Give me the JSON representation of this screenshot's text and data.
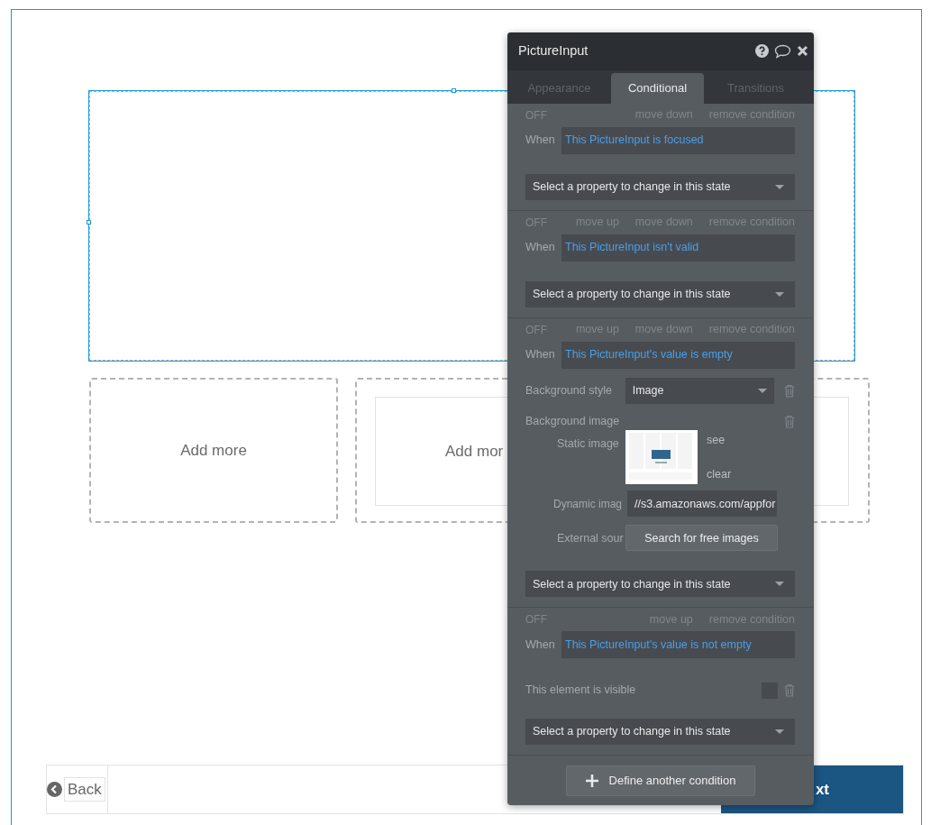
{
  "canvas": {
    "cards": [
      {
        "label": "Add more",
        "kind": "plain"
      },
      {
        "label": "Add mor",
        "kind": "framed"
      }
    ],
    "footer": {
      "back": "Back",
      "next": "xt"
    }
  },
  "panel": {
    "title": "PictureInput",
    "tabs": [
      {
        "label": "Appearance",
        "selected": false
      },
      {
        "label": "Conditional",
        "selected": true
      },
      {
        "label": "Transitions",
        "selected": false
      }
    ],
    "conditions": [
      {
        "status": "OFF",
        "actions": [
          "move down",
          "remove condition"
        ],
        "when_label": "When",
        "expression": "This PictureInput is focused",
        "property_select": "Select a property to change in this state"
      },
      {
        "status": "OFF",
        "actions": [
          "move up",
          "move down",
          "remove condition"
        ],
        "when_label": "When",
        "expression": "This PictureInput isn't valid",
        "property_select": "Select a property to change in this state"
      },
      {
        "status": "OFF",
        "actions": [
          "move up",
          "move down",
          "remove condition"
        ],
        "when_label": "When",
        "expression": "This PictureInput's value is empty",
        "properties": [
          {
            "kind": "dropdown",
            "label": "Background style",
            "value": "Image"
          },
          {
            "label": "Background image",
            "static_label": "Static image",
            "see": "see",
            "clear": "clear",
            "dynamic_label": "Dynamic imag",
            "dynamic_value": "//s3.amazonaws.com/appfor",
            "external_label": "External sour",
            "button": "Search for free images"
          }
        ],
        "property_select": "Select a property to change in this state"
      },
      {
        "status": "OFF",
        "actions": [
          "move up",
          "remove condition"
        ],
        "when_label": "When",
        "expression": "This PictureInput's value is not empty",
        "properties": [
          {
            "kind": "checkbox",
            "label": "This element is visible",
            "checked": false
          }
        ],
        "property_select": "Select a property to change in this state"
      }
    ],
    "add_button": "Define another condition"
  }
}
